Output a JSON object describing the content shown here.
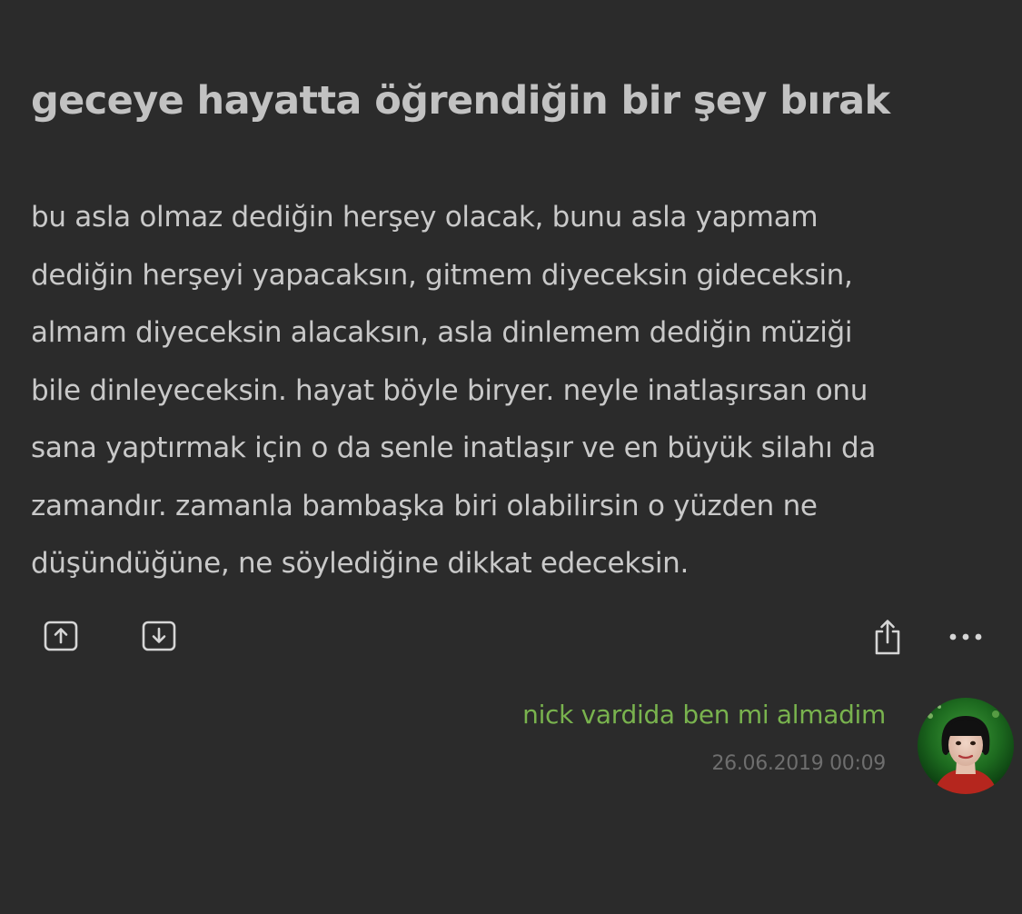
{
  "entry": {
    "title": "geceye hayatta öğrendiğin bir şey bırak",
    "body_lines": [
      "bu asla olmaz dediğin herşey olacak, bunu asla yapmam",
      "dediğin herşeyi yapacaksın, gitmem diyeceksin gideceksin,",
      "almam diyeceksin alacaksın, asla dinlemem dediğin müziği",
      "bile dinleyeceksin. hayat böyle biryer. neyle inatlaşırsan onu",
      "sana yaptırmak için o da senle inatlaşır ve en büyük silahı da",
      "zamandır. zamanla bambaşka biri olabilirsin o yüzden ne",
      "düşündüğüne, ne söylediğine dikkat edeceksin."
    ],
    "author": "nick vardida ben mi almadim",
    "date": "26.06.2019 00:09"
  },
  "actions": {
    "upvote_icon": "arrow-up-box-icon",
    "downvote_icon": "arrow-down-box-icon",
    "share_icon": "share-icon",
    "more_icon": "ellipsis-icon",
    "more_glyph": "•••"
  },
  "colors": {
    "background": "#2b2b2b",
    "title": "#c2c2c2",
    "text": "#c9c9c9",
    "author": "#79b34e",
    "date": "#6e6e6e",
    "icon": "#d6d6d6"
  }
}
